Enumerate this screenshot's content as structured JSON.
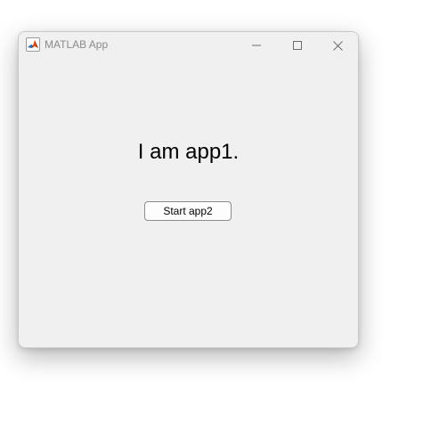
{
  "window": {
    "title": "MATLAB App",
    "icon": "matlab-logo-icon",
    "controls": {
      "minimize_icon": "minimize-icon",
      "maximize_icon": "maximize-icon",
      "close_icon": "close-icon"
    }
  },
  "main": {
    "heading": "I am app1.",
    "start_button_label": "Start app2"
  },
  "colors": {
    "window_background": "#f0f0f0",
    "title_text": "#8a8a8a",
    "button_border": "#8c8c8c"
  }
}
